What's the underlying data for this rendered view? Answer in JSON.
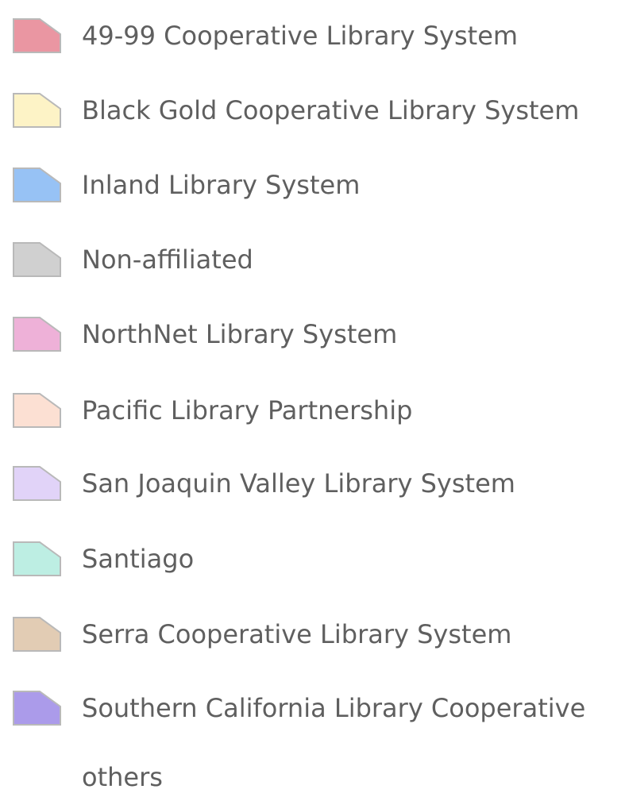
{
  "legend": {
    "items": [
      {
        "label": "49-99 Cooperative Library System",
        "color": "#ea96a2",
        "icon": "polygon-swatch-icon"
      },
      {
        "label": "Black Gold Cooperative Library System",
        "color": "#fdf3c6",
        "icon": "polygon-swatch-icon"
      },
      {
        "label": "Inland Library System",
        "color": "#97c2f5",
        "icon": "polygon-swatch-icon"
      },
      {
        "label": "Non-affiliated",
        "color": "#d0d0d0",
        "icon": "polygon-swatch-icon"
      },
      {
        "label": "NorthNet Library System",
        "color": "#eeb1d8",
        "icon": "polygon-swatch-icon"
      },
      {
        "label": "Pacific Library Partnership",
        "color": "#fce0d3",
        "icon": "polygon-swatch-icon"
      },
      {
        "label": "San Joaquin Valley Library System",
        "color": "#e1d3f8",
        "icon": "polygon-swatch-icon"
      },
      {
        "label": "Santiago",
        "color": "#bdeee3",
        "icon": "polygon-swatch-icon"
      },
      {
        "label": "Serra Cooperative Library System",
        "color": "#e2ccb4",
        "icon": "polygon-swatch-icon"
      },
      {
        "label": "Southern California Library Cooperative",
        "color": "#ab9bea",
        "icon": "polygon-swatch-icon"
      }
    ],
    "others_label": "others"
  }
}
